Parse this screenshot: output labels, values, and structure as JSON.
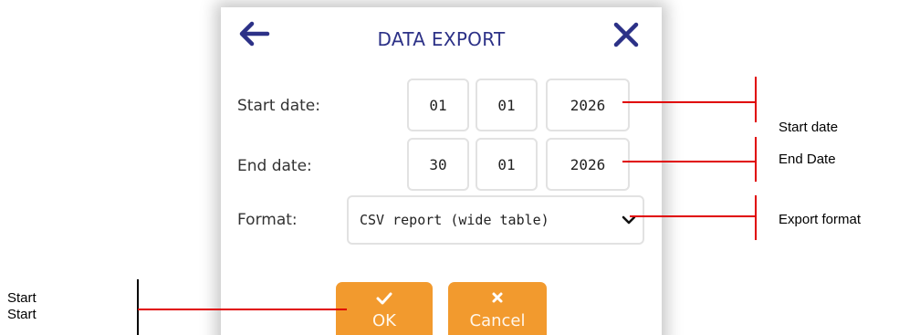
{
  "dialog": {
    "title": "DATA EXPORT",
    "back_icon": "back-arrow-icon",
    "close_icon": "close-icon",
    "accent_color": "#2c3187"
  },
  "start_date": {
    "label": "Start date:",
    "day": "01",
    "month": "01",
    "year": "2026"
  },
  "end_date": {
    "label": "End date:",
    "day": "30",
    "month": "01",
    "year": "2026"
  },
  "format": {
    "label": "Format:",
    "selected": "CSV report (wide table)",
    "chevron_icon": "chevron-down-icon"
  },
  "buttons": {
    "ok_label": "OK",
    "ok_icon": "check-icon",
    "cancel_label": "Cancel",
    "cancel_icon": "x-icon",
    "color": "#f29a2e"
  },
  "callouts": {
    "start_date": "Start date",
    "end_date": "End Date",
    "export_format": "Export format",
    "ok_line1": "Start",
    "ok_line2": "Start",
    "line_color": "#e00000"
  }
}
